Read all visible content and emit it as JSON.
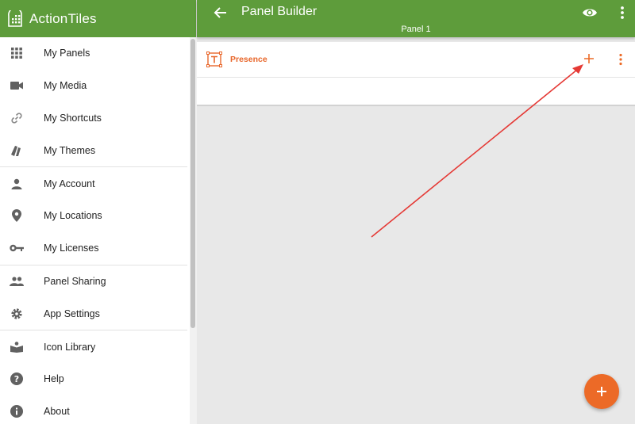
{
  "app": {
    "brand": "ActionTiles"
  },
  "sidebar": {
    "groups": [
      [
        {
          "label": "My Panels",
          "icon": "grid-icon"
        },
        {
          "label": "My Media",
          "icon": "video-camera-icon"
        },
        {
          "label": "My Shortcuts",
          "icon": "link-icon"
        },
        {
          "label": "My Themes",
          "icon": "palette-icon"
        }
      ],
      [
        {
          "label": "My Account",
          "icon": "person-icon"
        },
        {
          "label": "My Locations",
          "icon": "location-pin-icon"
        },
        {
          "label": "My Licenses",
          "icon": "key-icon"
        }
      ],
      [
        {
          "label": "Panel Sharing",
          "icon": "people-icon"
        },
        {
          "label": "App Settings",
          "icon": "gear-icon"
        }
      ],
      [
        {
          "label": "Icon Library",
          "icon": "book-icon"
        },
        {
          "label": "Help",
          "icon": "help-icon"
        },
        {
          "label": "About",
          "icon": "info-icon"
        }
      ]
    ]
  },
  "header": {
    "title": "Panel Builder",
    "subtitle": "Panel 1"
  },
  "section": {
    "title": "Presence",
    "icon": "text-box-icon"
  },
  "colors": {
    "primary": "#5e9c3b",
    "accent": "#ec6a27",
    "annotation": "#e53935"
  }
}
